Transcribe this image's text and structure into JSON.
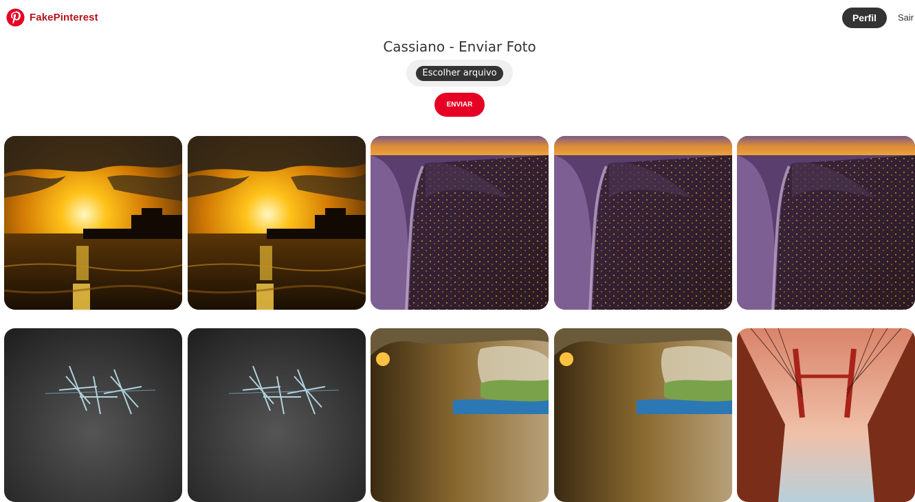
{
  "header": {
    "logo_text": "FakePinterest",
    "logo_icon": "pinterest-logo-icon",
    "perfil_label": "Perfil",
    "sair_label": "Sair"
  },
  "main": {
    "title": "Cassiano - Enviar Foto",
    "file_button_label": "Escolher arquivo",
    "submit_label": "ENVIAR"
  },
  "colors": {
    "brand": "#b5121b",
    "submit": "#e60023",
    "dark_button": "#333333"
  },
  "photos": [
    {
      "scene": "sunset-pier"
    },
    {
      "scene": "sunset-pier"
    },
    {
      "scene": "aerial-coastal-city"
    },
    {
      "scene": "aerial-coastal-city"
    },
    {
      "scene": "aerial-coastal-city"
    },
    {
      "scene": "ice-crystals"
    },
    {
      "scene": "ice-crystals"
    },
    {
      "scene": "sea-cave"
    },
    {
      "scene": "sea-cave"
    },
    {
      "scene": "suspension-bridge"
    }
  ]
}
